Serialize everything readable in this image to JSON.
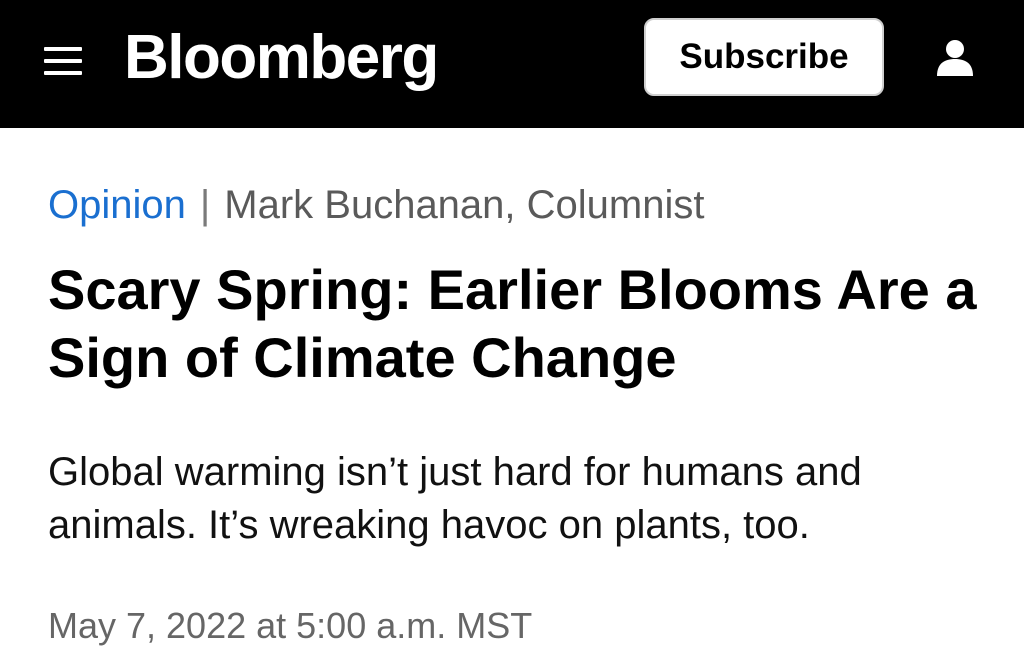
{
  "header": {
    "menu_icon": "hamburger-menu-icon",
    "logo_text": "Bloomberg",
    "subscribe_label": "Subscribe",
    "account_icon": "user-account-icon",
    "background_color": "#000000"
  },
  "article": {
    "category": "Opinion",
    "separator": "|",
    "byline": "Mark Buchanan, Columnist",
    "headline": "Scary Spring: Earlier Blooms Are a Sign of Climate Change",
    "dek": "Global warming isn’t just hard for humans and animals. It’s wreaking havoc on plants, too.",
    "timestamp": "May 7, 2022 at 5:00 a.m. MST"
  },
  "colors": {
    "category_link": "#1a6fd0",
    "byline_text": "#5a5a5a",
    "timestamp_text": "#666666"
  }
}
